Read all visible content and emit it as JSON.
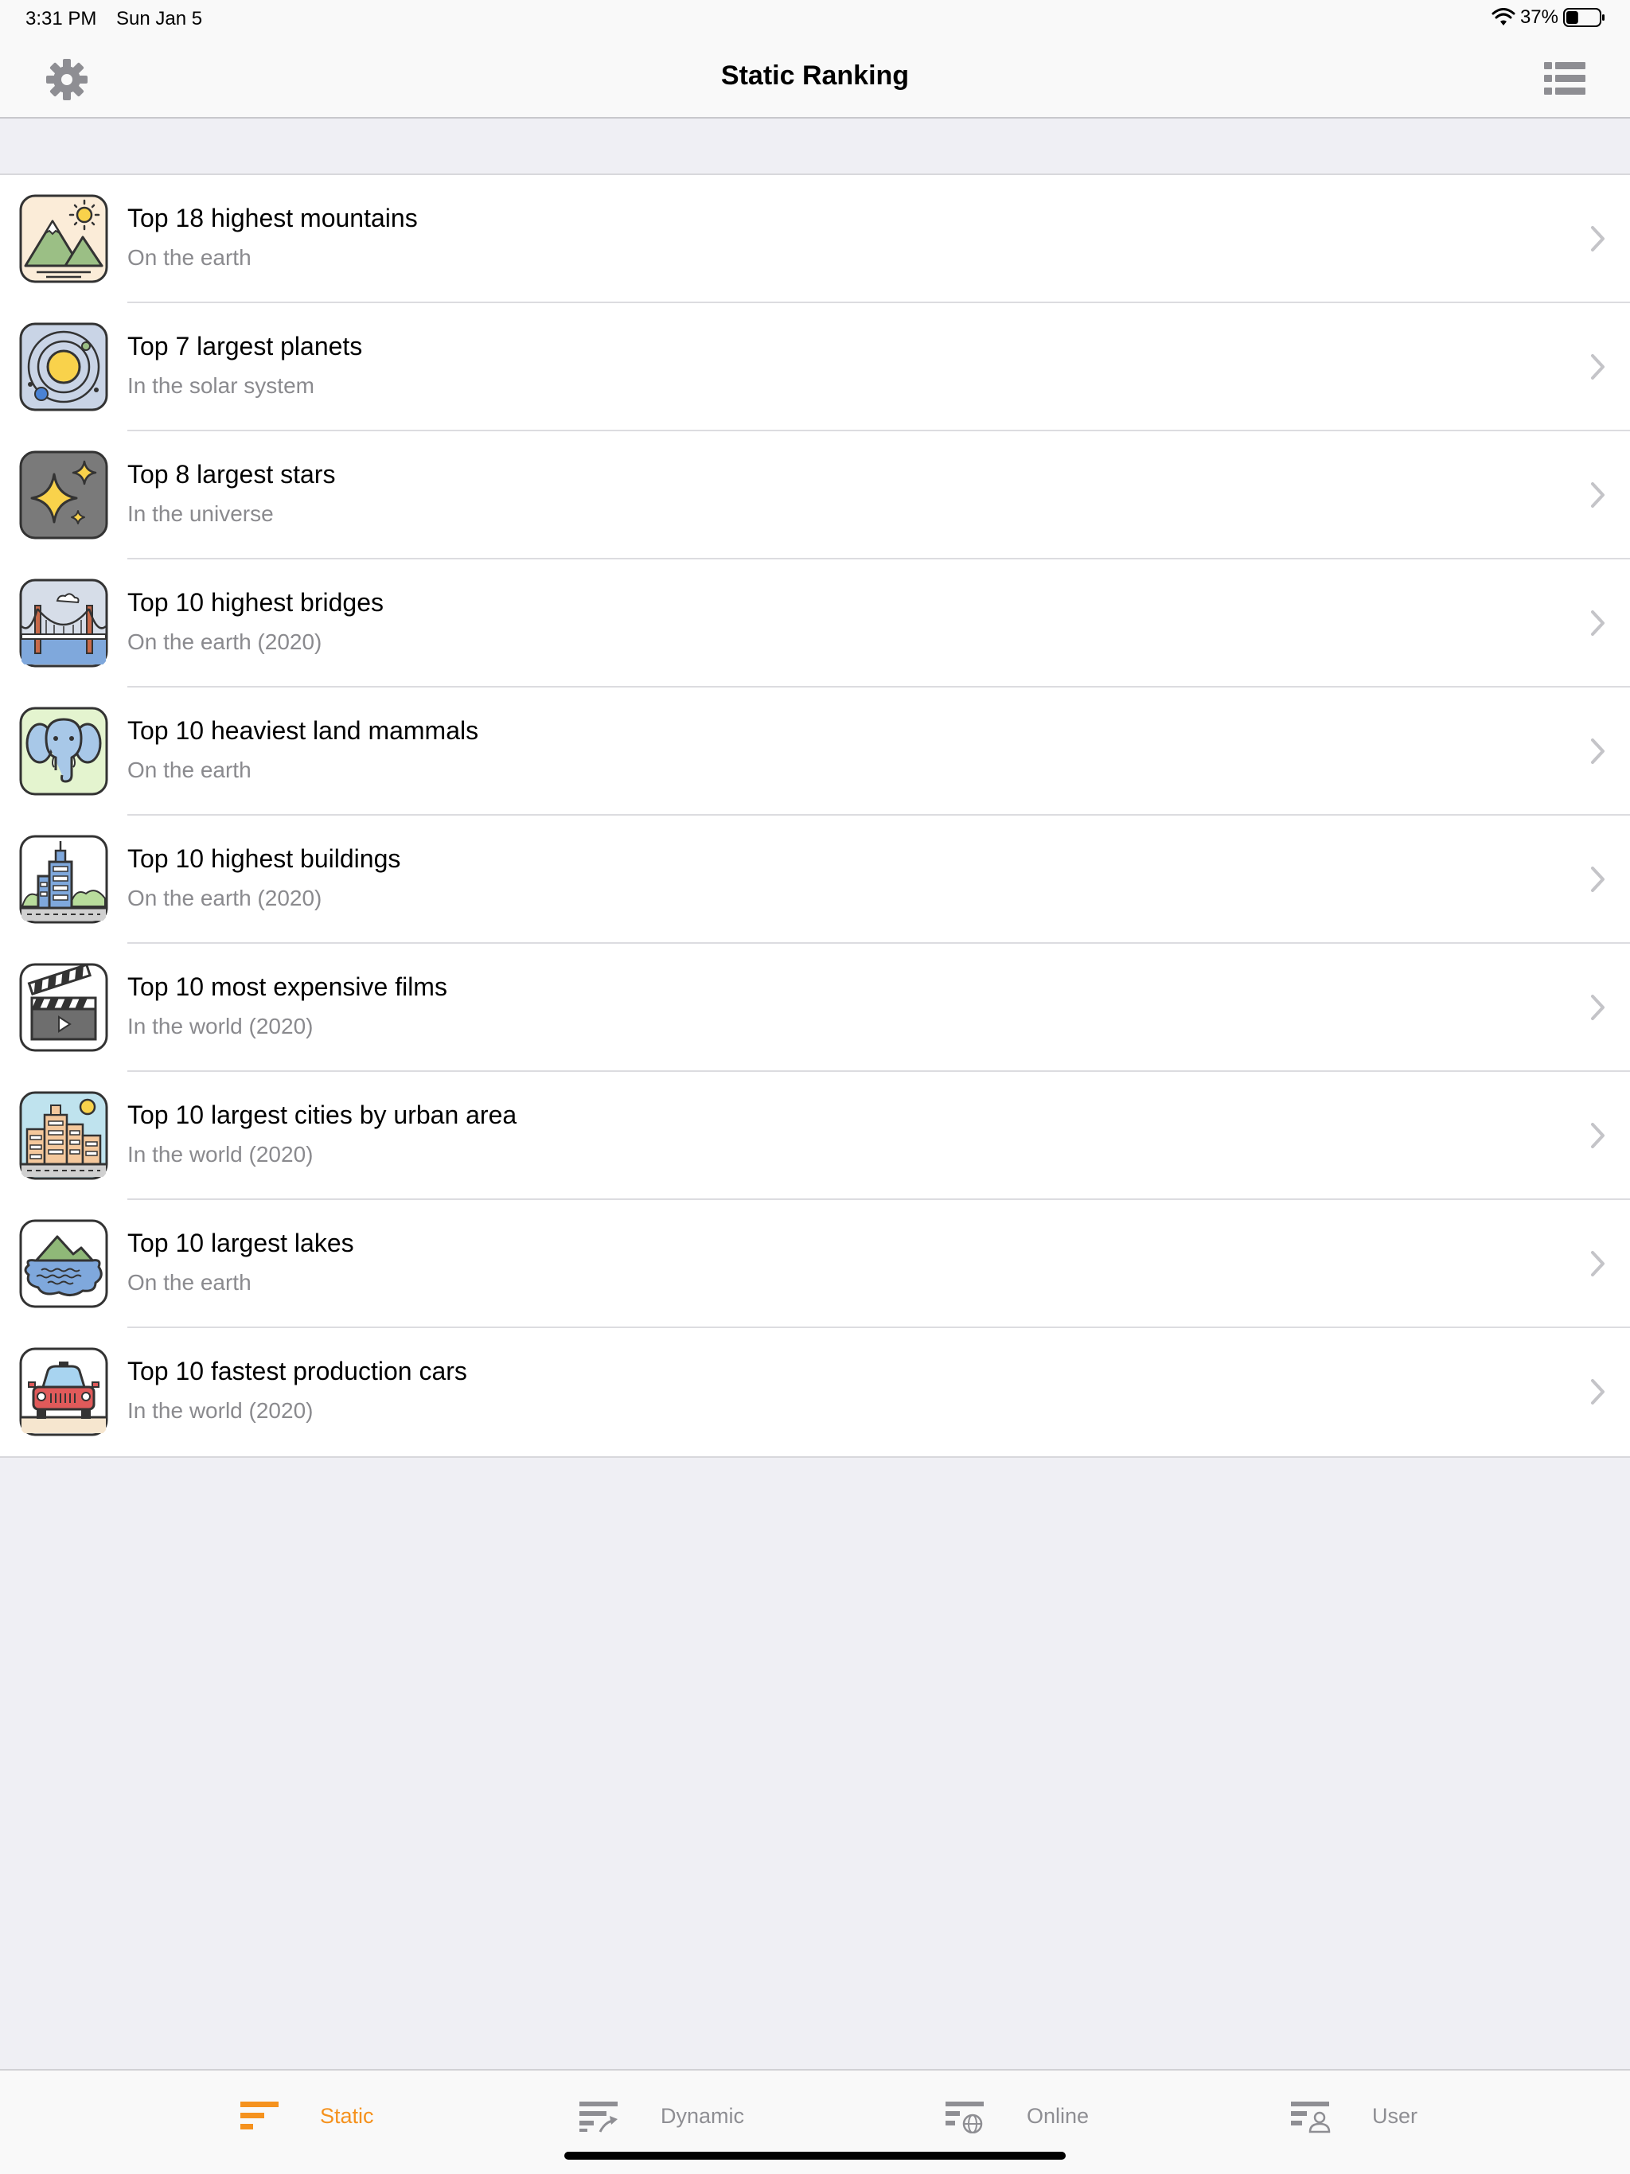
{
  "status_bar": {
    "time": "3:31 PM",
    "date": "Sun Jan 5",
    "battery": "37%",
    "battery_level": 0.37
  },
  "nav": {
    "title": "Static Ranking",
    "left_icon": "gear-icon",
    "right_icon": "list-icon"
  },
  "rankings": [
    {
      "title": "Top 18 highest mountains",
      "subtitle": "On the earth",
      "icon": "mountain-icon"
    },
    {
      "title": "Top 7 largest planets",
      "subtitle": "In the solar system",
      "icon": "planet-icon"
    },
    {
      "title": "Top 8 largest stars",
      "subtitle": "In the universe",
      "icon": "stars-icon"
    },
    {
      "title": "Top 10 highest bridges",
      "subtitle": "On the earth (2020)",
      "icon": "bridge-icon"
    },
    {
      "title": "Top 10 heaviest land mammals",
      "subtitle": "On the earth",
      "icon": "elephant-icon"
    },
    {
      "title": "Top 10 highest buildings",
      "subtitle": "On the earth (2020)",
      "icon": "buildings-icon"
    },
    {
      "title": "Top 10 most expensive films",
      "subtitle": "In the world (2020)",
      "icon": "clapperboard-icon"
    },
    {
      "title": "Top 10 largest cities by urban area",
      "subtitle": "In the world (2020)",
      "icon": "city-icon"
    },
    {
      "title": "Top 10 largest lakes",
      "subtitle": "On the earth",
      "icon": "lake-icon"
    },
    {
      "title": "Top 10 fastest production cars",
      "subtitle": "In the world (2020)",
      "icon": "car-icon"
    }
  ],
  "tabs": [
    {
      "label": "Static",
      "icon": "static-tab-icon",
      "active": true
    },
    {
      "label": "Dynamic",
      "icon": "dynamic-tab-icon",
      "active": false
    },
    {
      "label": "Online",
      "icon": "online-tab-icon",
      "active": false
    },
    {
      "label": "User",
      "icon": "user-tab-icon",
      "active": false
    }
  ],
  "colors": {
    "accent": "#f5921e",
    "inactive_tab": "#8e8e93",
    "background": "#efeff4",
    "subtitle": "#8a8a8e"
  }
}
